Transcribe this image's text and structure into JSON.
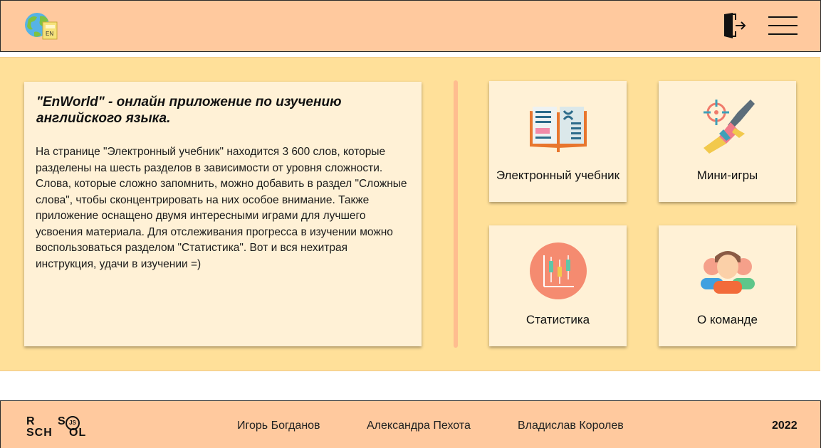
{
  "header": {
    "logo_icon": "globe-dictionary-icon",
    "logout_icon": "logout-door-icon",
    "menu_icon": "hamburger-menu-icon"
  },
  "info": {
    "title": "\"EnWorld\" - онлайн приложение по изучению английского языка.",
    "text": "На странице \"Электронный учебник\" находится 3 600 слов, которые разделены на шесть разделов в зависимости от уровня сложности. Слова, которые сложно запомнить, можно добавить в раздел \"Сложные слова\", чтобы сконцентрировать на них особое внимание. Также приложение оснащено двумя интересными играми для лучшего усвоения материала. Для отслеживания прогресса в изучении можно воспользоваться разделом \"Статистика\". Вот и вся нехитрая инструкция, удачи в изучении =)"
  },
  "tiles": [
    {
      "label": "Электронный учебник",
      "icon": "open-book-icon"
    },
    {
      "label": "Мини-игры",
      "icon": "game-gun-target-icon"
    },
    {
      "label": "Статистика",
      "icon": "statistics-chart-icon"
    },
    {
      "label": "О команде",
      "icon": "team-people-icon"
    }
  ],
  "footer": {
    "logo_lines": [
      "R",
      "S",
      "SCH",
      "OL"
    ],
    "logo_js": "JS",
    "logo_text": "RS SCHOOL JS",
    "authors": [
      "Игорь Богданов",
      "Александра Пехота",
      "Владислав Королев"
    ],
    "year": "2022"
  },
  "colors": {
    "header_bg": "#ffc99e",
    "main_bg": "#ffe099",
    "card_bg": "#fff1d6",
    "divider": "#ffbd8f"
  }
}
